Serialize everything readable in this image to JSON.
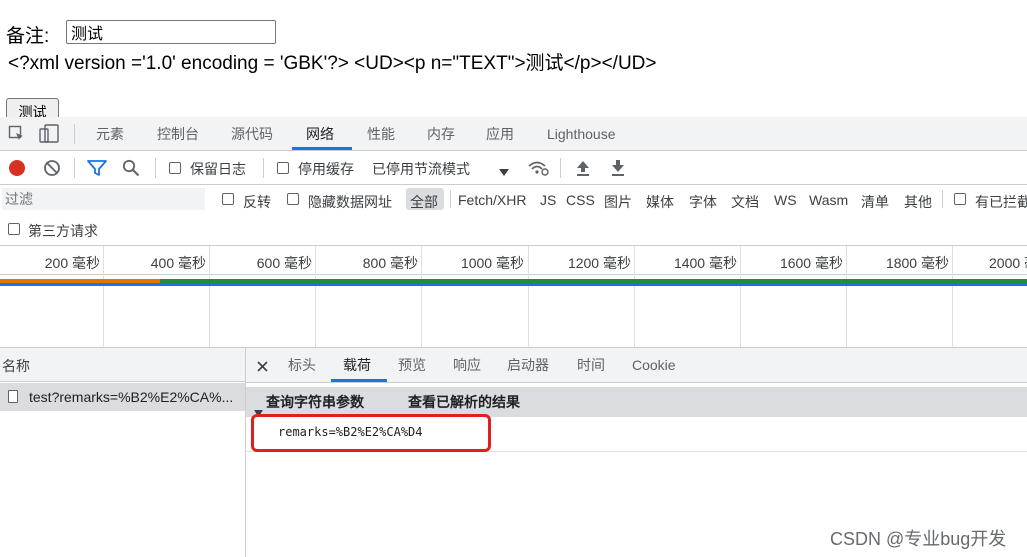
{
  "page": {
    "remark_label": "备注:",
    "remark_value": "测试",
    "xml_line": "<?xml version ='1.0' encoding = 'GBK'?> <UD><p n=\"TEXT\">测试</p></UD>",
    "test_button": "测试"
  },
  "devtools": {
    "tabs": [
      "元素",
      "控制台",
      "源代码",
      "网络",
      "性能",
      "内存",
      "应用",
      "Lighthouse"
    ],
    "active_tab": "网络",
    "toolbar": {
      "preserve_log": "保留日志",
      "disable_cache": "停用缓存",
      "throttling": "已停用节流模式"
    },
    "filter": {
      "placeholder": "过滤",
      "invert": "反转",
      "hide_data_urls": "隐藏数据网址",
      "types": [
        "全部",
        "Fetch/XHR",
        "JS",
        "CSS",
        "图片",
        "媒体",
        "字体",
        "文档",
        "WS",
        "Wasm",
        "清单",
        "其他"
      ],
      "blocked": "有已拦截",
      "third_party": "第三方请求"
    },
    "timeline": {
      "ticks": [
        "200 毫秒",
        "400 毫秒",
        "600 毫秒",
        "800 毫秒",
        "1000 毫秒",
        "1200 毫秒",
        "1400 毫秒",
        "1600 毫秒",
        "1800 毫秒",
        "2000 毫"
      ]
    },
    "requests": {
      "header": "名称",
      "rows": [
        "test?remarks=%B2%E2%CA%..."
      ]
    },
    "detail": {
      "tabs": [
        "标头",
        "载荷",
        "预览",
        "响应",
        "启动器",
        "时间",
        "Cookie"
      ],
      "active_tab": "载荷",
      "section_title": "查询字符串参数",
      "view_parsed": "查看已解析的结果",
      "param": "remarks=%B2%E2%CA%D4"
    }
  },
  "watermark": "CSDN @专业bug开发",
  "colors": {
    "accent": "#1a73e8",
    "record": "#d93025",
    "highlight_box": "#e02020"
  }
}
